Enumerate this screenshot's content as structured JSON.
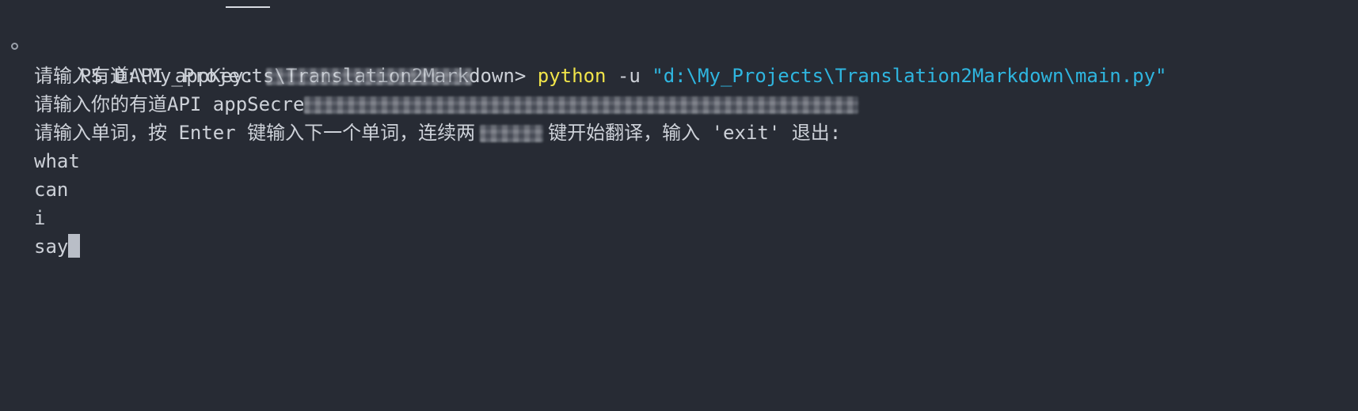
{
  "terminal": {
    "prompt": "PS D:\\My_Projects\\Translation2Markdown> ",
    "command": {
      "exe": "python",
      "flag": "-u",
      "arg": "\"d:\\My_Projects\\Translation2Markdown\\main.py\""
    },
    "lines": {
      "app_key_prompt": "请输入有道API appKey: ",
      "app_secret_prompt": "请输入你的有道API appSecre",
      "word_prompt_part1": "请输入单词，按 Enter 键输入下一个单词，连续两",
      "word_prompt_part2": "键开始翻译，输入 'exit' 退出:"
    },
    "inputs": [
      "what",
      "can",
      "i",
      "say"
    ]
  }
}
